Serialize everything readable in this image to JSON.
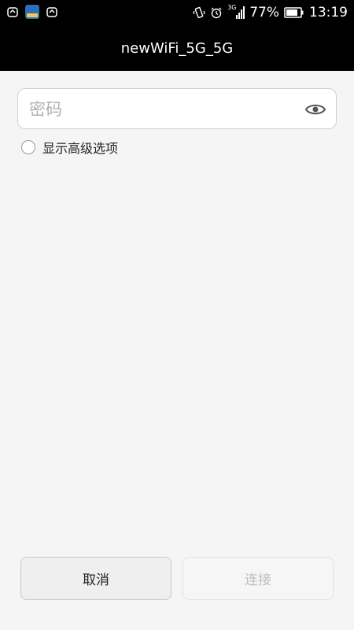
{
  "status_bar": {
    "battery": "77%",
    "time": "13:19",
    "network_type": "3G",
    "left_icons": [
      "notification-icon",
      "app-icon",
      "notification-icon"
    ],
    "right_icons": [
      "vibrate-icon",
      "alarm-icon",
      "signal-icon",
      "battery-icon"
    ]
  },
  "dialog": {
    "title": "newWiFi_5G_5G",
    "password_placeholder": "密码",
    "password_value": "",
    "show_advanced_label": "显示高级选项",
    "cancel_label": "取消",
    "connect_label": "连接"
  },
  "colors": {
    "status_bar_bg": "#000000",
    "page_bg": "#f5f5f5",
    "disabled_text": "#bdbdbd"
  }
}
